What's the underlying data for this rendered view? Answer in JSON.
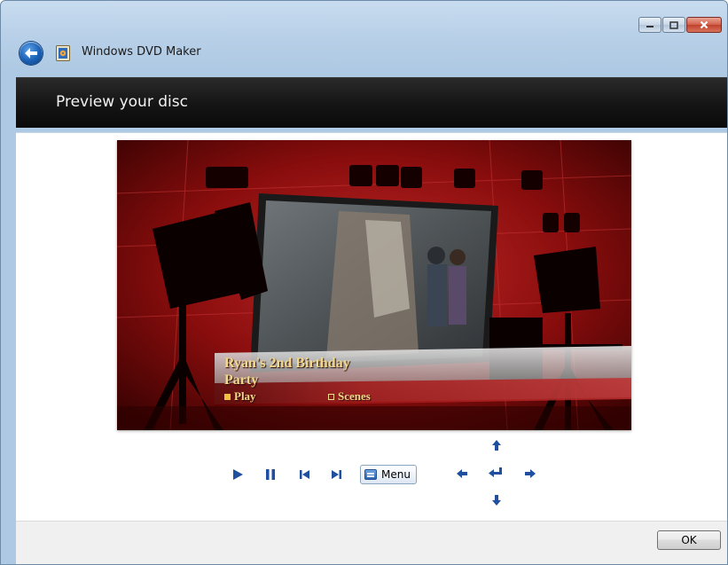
{
  "window": {
    "title": "Windows DVD Maker",
    "caption_buttons": [
      "minimize",
      "maximize",
      "close"
    ]
  },
  "header": {
    "title": "Preview your disc"
  },
  "preview": {
    "disc_title_line1": "Ryan's 2nd Birthday",
    "disc_title_line2": "Party",
    "menu_items": [
      {
        "label": "Play",
        "selected": true
      },
      {
        "label": "Scenes",
        "selected": false
      }
    ],
    "colors": {
      "text": "#f0d98a",
      "selected_square": "#f0c040",
      "background": "#7a0a0a"
    }
  },
  "controls": {
    "play_icon": "play-icon",
    "pause_icon": "pause-icon",
    "previous_icon": "skip-previous-icon",
    "next_icon": "skip-next-icon",
    "menu_label": "Menu",
    "nav_icons": [
      "arrow-up-icon",
      "arrow-left-icon",
      "enter-icon",
      "arrow-right-icon",
      "arrow-down-icon"
    ],
    "accent": "#1f4f9e"
  },
  "footer": {
    "ok_label": "OK"
  }
}
